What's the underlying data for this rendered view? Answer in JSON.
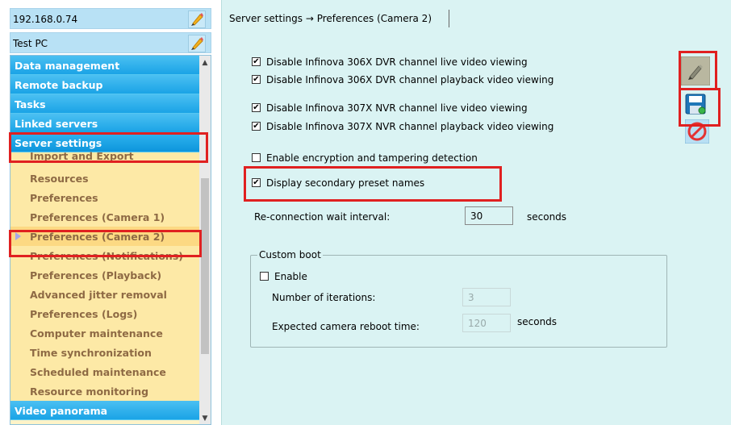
{
  "sidebar": {
    "host": {
      "address": "192.168.0.74",
      "pc_name": "Test PC"
    },
    "categories_top": [
      "Data management",
      "Remote backup",
      "Tasks",
      "Linked servers",
      "Server settings"
    ],
    "server_settings_items": [
      "Import and Export",
      "Resources",
      "Preferences",
      "Preferences (Camera 1)",
      "Preferences (Camera 2)",
      "Preferences (Notifications)",
      "Preferences (Playback)",
      "Advanced jitter removal",
      "Preferences (Logs)",
      "Computer maintenance",
      "Time synchronization",
      "Scheduled maintenance",
      "Resource monitoring"
    ],
    "categories_bottom": [
      "Video panorama"
    ],
    "selected_item": "Preferences (Camera 2)"
  },
  "main": {
    "title": "Server settings → Preferences (Camera 2)",
    "checkboxes": [
      {
        "label": "Disable Infinova 306X DVR channel live video viewing",
        "checked": true,
        "mark": "✔"
      },
      {
        "label": "Disable Infinova 306X DVR channel playback video viewing",
        "checked": true,
        "mark": "✔"
      },
      {
        "label": "Disable Infinova 307X NVR channel live video viewing",
        "checked": true,
        "mark": "✔"
      },
      {
        "label": "Disable Infinova 307X NVR channel playback video viewing",
        "checked": true,
        "mark": "✔"
      },
      {
        "label": "Enable encryption and tampering detection",
        "checked": false,
        "mark": ""
      },
      {
        "label": "Display secondary preset names",
        "checked": true,
        "mark": "✔"
      }
    ],
    "reconnect": {
      "label": "Re-connection wait interval:",
      "value": "30",
      "unit": "seconds"
    },
    "custom_boot": {
      "legend": "Custom boot",
      "enable": {
        "label": "Enable",
        "checked": false,
        "mark": ""
      },
      "iterations": {
        "label": "Number of iterations:",
        "value": "3"
      },
      "reboot_time": {
        "label": "Expected camera reboot time:",
        "value": "120",
        "unit": "seconds"
      }
    }
  },
  "toolbar": {
    "icons": [
      "edit-icon",
      "save-icon",
      "cancel-icon"
    ]
  },
  "colors": {
    "category_blue": "#1aa3e6",
    "subitem_yellow": "#fde9a6",
    "subitem_text": "#8e6a44",
    "panel_background": "#daf3f3",
    "highlight_red": "#e02020"
  }
}
